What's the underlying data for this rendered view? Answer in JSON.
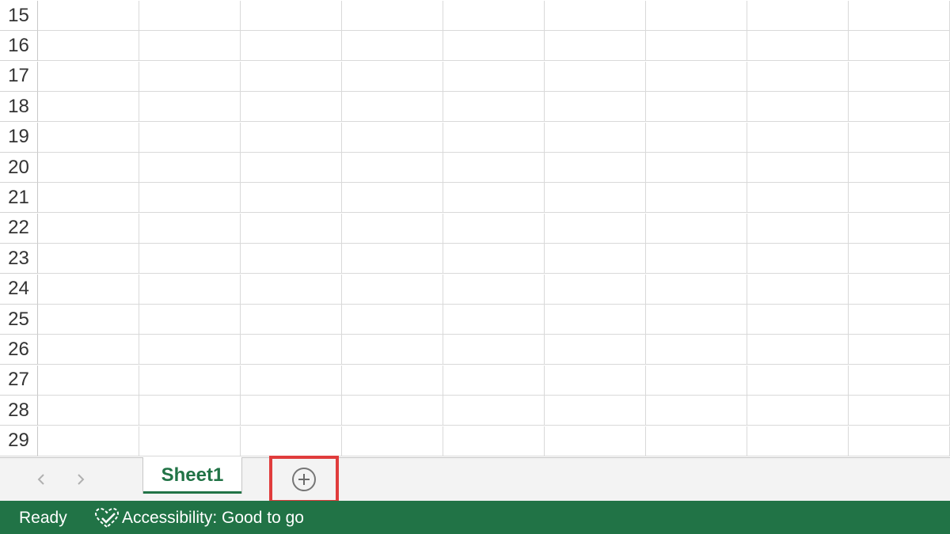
{
  "grid": {
    "rows": [
      "15",
      "16",
      "17",
      "18",
      "19",
      "20",
      "21",
      "22",
      "23",
      "24",
      "25",
      "26",
      "27",
      "28",
      "29"
    ]
  },
  "tabs": {
    "prev_icon": "chevron-left-icon",
    "next_icon": "chevron-right-icon",
    "sheet_name": "Sheet1",
    "add_icon": "plus-circle-icon"
  },
  "status": {
    "ready": "Ready",
    "accessibility": "Accessibility: Good to go",
    "accessibility_icon": "accessibility-check-icon"
  },
  "colors": {
    "accent": "#217346",
    "highlight": "#e03c3c"
  }
}
